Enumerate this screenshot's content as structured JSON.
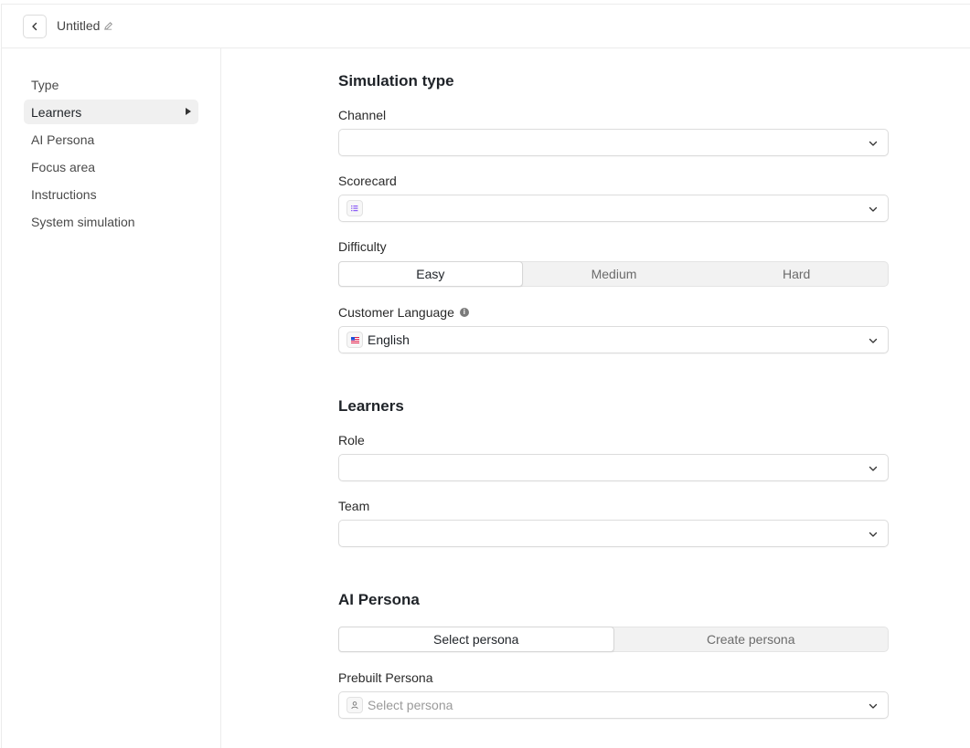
{
  "header": {
    "title": "Untitled"
  },
  "sidebar": {
    "items": [
      {
        "label": "Type"
      },
      {
        "label": "Learners"
      },
      {
        "label": "AI Persona"
      },
      {
        "label": "Focus area"
      },
      {
        "label": "Instructions"
      },
      {
        "label": "System simulation"
      }
    ],
    "active_index": 1
  },
  "simulation_type": {
    "title": "Simulation type",
    "channel": {
      "label": "Channel",
      "value": ""
    },
    "scorecard": {
      "label": "Scorecard",
      "value": ""
    },
    "difficulty": {
      "label": "Difficulty",
      "options": [
        "Easy",
        "Medium",
        "Hard"
      ],
      "selected": "Easy"
    },
    "customer_language": {
      "label": "Customer Language",
      "value": "English"
    }
  },
  "learners": {
    "title": "Learners",
    "role": {
      "label": "Role",
      "value": ""
    },
    "team": {
      "label": "Team",
      "value": ""
    }
  },
  "ai_persona": {
    "title": "AI Persona",
    "tabs": [
      "Select persona",
      "Create persona"
    ],
    "selected_tab": "Select persona",
    "prebuilt": {
      "label": "Prebuilt Persona",
      "placeholder": "Select persona"
    }
  },
  "colors": {
    "scorecard_icon": "#8b5cf6",
    "active_nav_bg": "#f0f0f0",
    "border": "#dcdcdc"
  },
  "icons": {
    "back": "chevron-left-icon",
    "edit": "pencil-icon",
    "dropdown": "chevron-down-icon",
    "scorecard": "list-icon",
    "language": "us-flag-icon",
    "persona": "user-icon",
    "info": "info-icon"
  }
}
